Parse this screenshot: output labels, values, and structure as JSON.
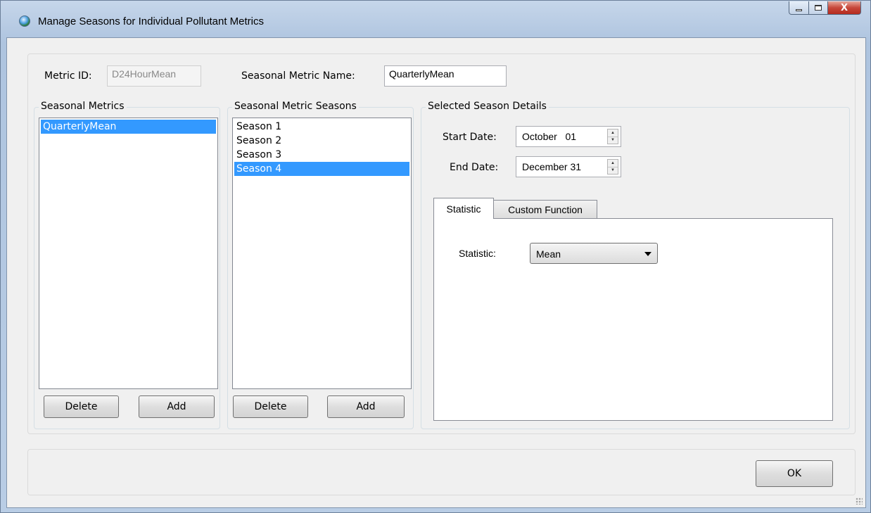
{
  "window": {
    "title": "Manage Seasons for Individual Pollutant Metrics",
    "close_glyph": "X",
    "icons": [
      "app-globe-icon",
      "minimize-icon",
      "maximize-icon",
      "close-icon"
    ]
  },
  "metric": {
    "id_label": "Metric ID:",
    "id_value": "D24HourMean",
    "name_label": "Seasonal Metric Name:",
    "name_value": "QuarterlyMean"
  },
  "seasonal_metrics": {
    "title": "Seasonal Metrics",
    "items": [
      "QuarterlyMean"
    ],
    "selected_index": 0,
    "delete_label": "Delete",
    "add_label": "Add"
  },
  "seasons": {
    "title": "Seasonal Metric Seasons",
    "items": [
      "Season 1",
      "Season 2",
      "Season 3",
      "Season 4"
    ],
    "selected_index": 3,
    "delete_label": "Delete",
    "add_label": "Add"
  },
  "details": {
    "title": "Selected Season Details",
    "start_label": "Start Date:",
    "start_value": "October   01",
    "end_label": "End Date:",
    "end_value": "December 31",
    "tabs": [
      "Statistic",
      "Custom Function"
    ],
    "active_tab": 0,
    "statistic_label": "Statistic:",
    "statistic_value": "Mean"
  },
  "footer": {
    "ok_label": "OK"
  },
  "colors": {
    "selection": "#3399ff",
    "client_bg": "#f0f0f0",
    "close_button": "#c7473a"
  }
}
